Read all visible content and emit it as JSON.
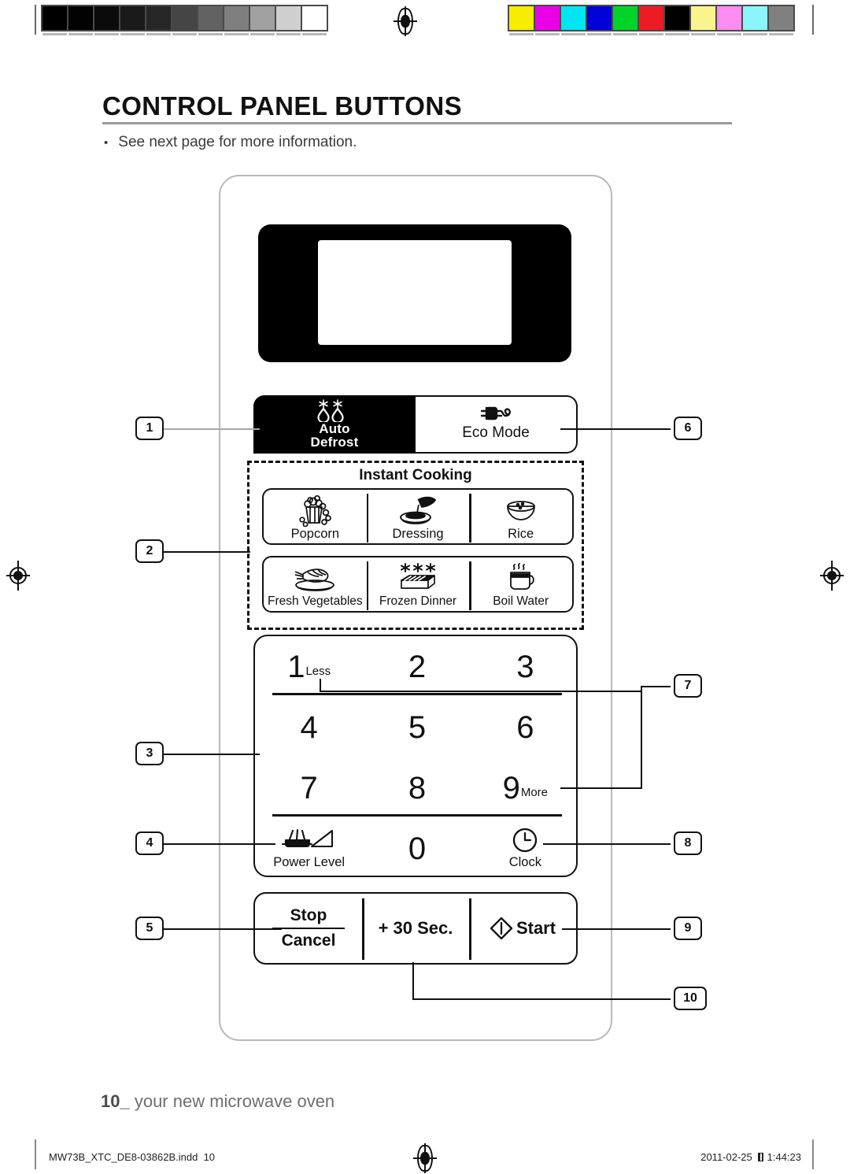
{
  "document": {
    "heading": "CONTROL PANEL BUTTONS",
    "bullet": "See next page for more information.",
    "bullet_marker": "•",
    "folio_number": "10_",
    "folio_text": " your new microwave oven",
    "footer_file": "MW73B_XTC_DE8-03862B.indd",
    "footer_page": "10",
    "footer_date": "2011-02-25",
    "footer_time": "1:44:23",
    "footer_time_marker": "▩▩"
  },
  "calibration": {
    "gray_swatches": [
      "#000000",
      "#020202",
      "#0b0b0b",
      "#1a1a1a",
      "#272727",
      "#454545",
      "#626262",
      "#7f7f7f",
      "#a0a0a0",
      "#cfcfcf",
      "#ffffff"
    ],
    "color_swatches": [
      "#f8ec00",
      "#ea00e6",
      "#00e6f0",
      "#0000d8",
      "#00d428",
      "#ed1c24",
      "#000000",
      "#fbf48c",
      "#fb8cf0",
      "#8cf5fb",
      "#808080"
    ]
  },
  "panel": {
    "display": {
      "name": "display-window"
    },
    "defrost_button": {
      "line1": "Auto",
      "line2": "Defrost",
      "icon": "snowflake-droplet-icon"
    },
    "eco_button": {
      "label": "Eco Mode",
      "icon": "power-plug-icon"
    },
    "instant_cooking": {
      "title": "Instant Cooking",
      "row1": [
        {
          "label": "Popcorn",
          "icon": "popcorn-icon"
        },
        {
          "label": "Dressing",
          "icon": "dressing-bowl-icon"
        },
        {
          "label": "Rice",
          "icon": "rice-bowl-icon"
        }
      ],
      "row2": [
        {
          "label": "Fresh Vegetables",
          "icon": "vegetable-plate-icon"
        },
        {
          "label": "Frozen Dinner",
          "icon": "frozen-dinner-icon"
        },
        {
          "label": "Boil Water",
          "icon": "steaming-mug-icon"
        }
      ]
    },
    "keypad": {
      "row1": [
        {
          "num": "1",
          "sub": "Less"
        },
        {
          "num": "2",
          "sub": ""
        },
        {
          "num": "3",
          "sub": ""
        }
      ],
      "row2": [
        {
          "num": "4",
          "sub": ""
        },
        {
          "num": "5",
          "sub": ""
        },
        {
          "num": "6",
          "sub": ""
        }
      ],
      "row3": [
        {
          "num": "7",
          "sub": ""
        },
        {
          "num": "8",
          "sub": ""
        },
        {
          "num": "9",
          "sub": "More"
        }
      ],
      "row4": [
        {
          "num": "",
          "label": "Power Level",
          "icon": "power-level-icon"
        },
        {
          "num": "0",
          "label": "",
          "icon": ""
        },
        {
          "num": "",
          "label": "Clock",
          "icon": "clock-icon"
        }
      ]
    },
    "bottom": {
      "stop": "Stop",
      "cancel": "Cancel",
      "add30": "+ 30 Sec.",
      "start": "Start",
      "start_icon": "start-diamond-icon"
    }
  },
  "callouts": {
    "left": [
      "1",
      "2",
      "3",
      "4",
      "5"
    ],
    "right": [
      "6",
      "7",
      "8",
      "9",
      "10"
    ]
  }
}
